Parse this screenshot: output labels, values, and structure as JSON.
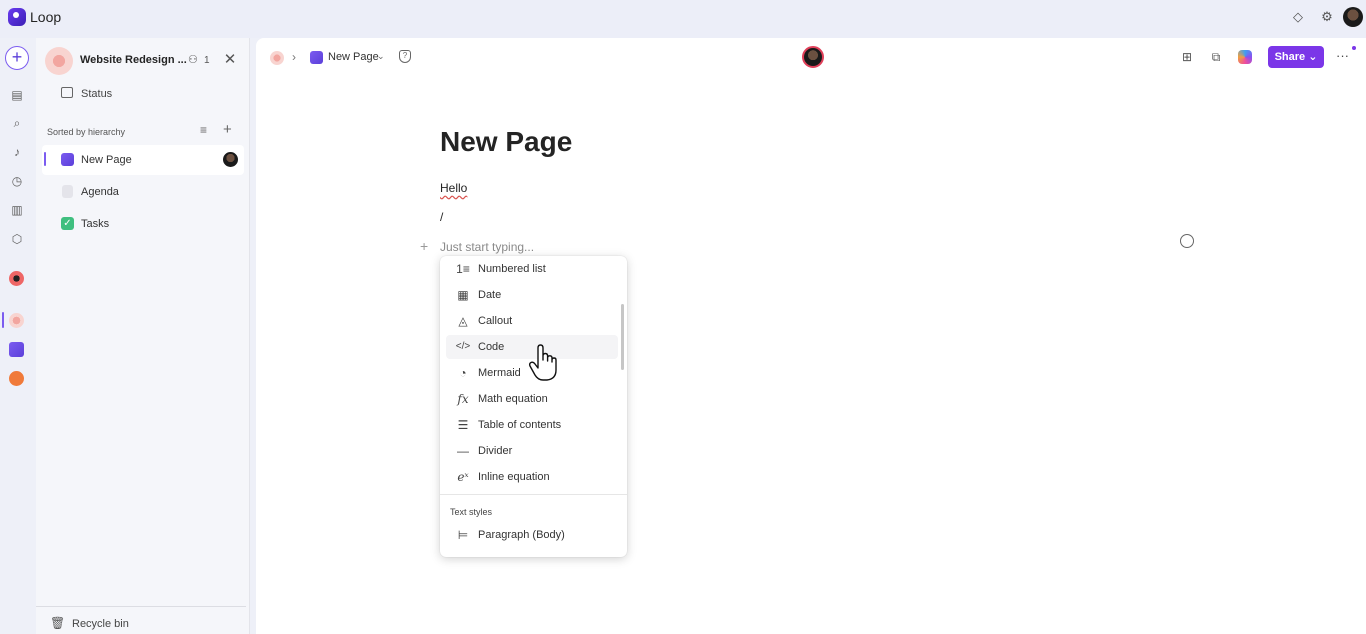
{
  "app": {
    "title": "Loop"
  },
  "topbar": {
    "icons": [
      "diamond-icon",
      "gear-icon"
    ]
  },
  "sidebar": {
    "workspace_title": "Website Redesign ...",
    "members_count": "1",
    "status_label": "Status",
    "sort_label": "Sorted by hierarchy",
    "pages": [
      {
        "label": "New Page",
        "active": true
      },
      {
        "label": "Agenda",
        "active": false
      },
      {
        "label": "Tasks",
        "active": false
      }
    ],
    "recycle_label": "Recycle bin"
  },
  "breadcrumb": {
    "separator": "›",
    "page": "New Page"
  },
  "toolbar": {
    "share_label": "Share",
    "more": "···"
  },
  "document": {
    "title": "New Page",
    "lines": [
      "Hello",
      "/"
    ],
    "placeholder": "Just start typing..."
  },
  "slash_menu": {
    "items": [
      {
        "label": "Numbered list",
        "icon": "numbered-list-icon",
        "glyph": "1≡"
      },
      {
        "label": "Date",
        "icon": "calendar-icon",
        "glyph": "▦"
      },
      {
        "label": "Callout",
        "icon": "callout-icon",
        "glyph": "◬"
      },
      {
        "label": "Code",
        "icon": "code-icon",
        "glyph": "</>"
      },
      {
        "label": "Mermaid",
        "icon": "mermaid-icon",
        "glyph": "◔"
      },
      {
        "label": "Math equation",
        "icon": "function-icon",
        "glyph": "fx"
      },
      {
        "label": "Table of contents",
        "icon": "table-of-contents-icon",
        "glyph": "☰"
      },
      {
        "label": "Divider",
        "icon": "divider-icon",
        "glyph": "—"
      },
      {
        "label": "Inline equation",
        "icon": "inline-equation-icon",
        "glyph": "eˣ"
      }
    ],
    "section_label": "Text styles",
    "section_items": [
      {
        "label": "Paragraph (Body)",
        "icon": "paragraph-icon",
        "glyph": "⊨"
      }
    ],
    "hovered": "Code"
  },
  "colors": {
    "accent": "#7b36e8",
    "presence_ring": "#e0405a"
  }
}
